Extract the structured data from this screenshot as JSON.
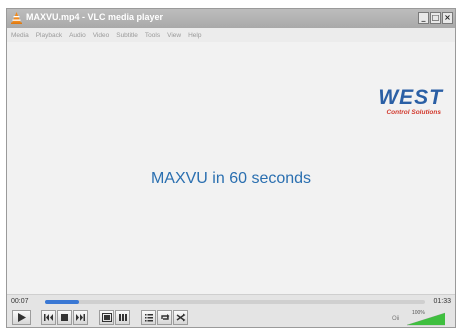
{
  "window": {
    "title": "MAXVU.mp4 - VLC media player",
    "controls": {
      "minimize": "_",
      "maximize": "□",
      "close": "×"
    }
  },
  "menu": {
    "items": [
      "Media",
      "Playback",
      "Audio",
      "Video",
      "Subtitle",
      "Tools",
      "View",
      "Help"
    ]
  },
  "video": {
    "logo_main": "WEST",
    "logo_sub": "Control Solutions",
    "title_text": "MAXVU in 60 seconds"
  },
  "player": {
    "time_elapsed": "00:07",
    "time_total": "01:33",
    "progress_fraction": 0.09,
    "volume_percent": 100,
    "volume_label": "100%",
    "mute_label": "Oii",
    "buttons": [
      "play-icon",
      "previous-icon",
      "stop-icon",
      "next-icon",
      "fullscreen-icon",
      "extended-settings-icon",
      "playlist-icon",
      "loop-icon",
      "shuffle-icon"
    ]
  },
  "colors": {
    "accent": "#3a78d4",
    "logo_blue": "#2a5fa5",
    "logo_red": "#d23a2e",
    "title_blue": "#2a6fb0",
    "volume_green": "#3fbf3f"
  }
}
